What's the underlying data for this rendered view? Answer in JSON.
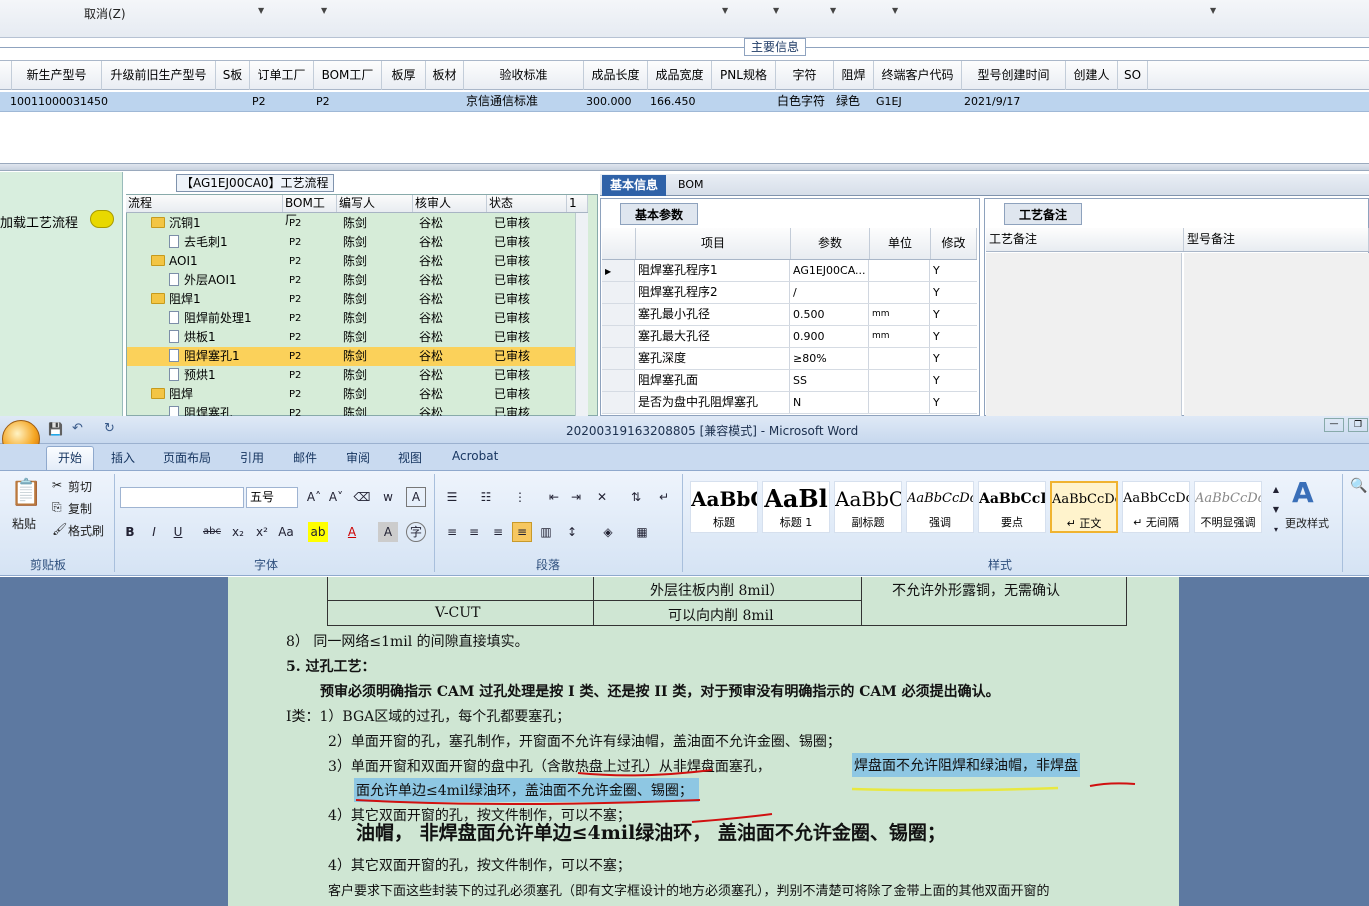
{
  "erp": {
    "cancel_label": "取消(Z)",
    "section_title": "主要信息",
    "columns": [
      "新生产型号",
      "升级前旧生产型号",
      "S板",
      "订单工厂",
      "BOM工厂",
      "板厚",
      "板材",
      "验收标准",
      "成品长度",
      "成品宽度",
      "PNL规格",
      "字符",
      "阻焊",
      "终端客户代码",
      "型号创建时间",
      "创建人",
      "SO"
    ],
    "row": [
      "10011000031450",
      "",
      "",
      "P2",
      "P2",
      "",
      "",
      "京信通信标准",
      "300.000",
      "166.450",
      "",
      "白色字符",
      "绿色",
      "G1EJ",
      "2021/9/17",
      "",
      ""
    ]
  },
  "flow": {
    "left_label": "加载工艺流程",
    "title": "【AG1EJ00CA0】工艺流程",
    "columns": [
      "流程",
      "BOM工厂",
      "编写人",
      "核审人",
      "状态",
      "1"
    ],
    "rows": [
      {
        "name": "沉铜1",
        "type": "folder",
        "level": 0,
        "bom": "P2",
        "writer": "陈剑",
        "reviewer": "谷松",
        "status": "已审核"
      },
      {
        "name": "去毛刺1",
        "type": "doc",
        "level": 1,
        "bom": "P2",
        "writer": "陈剑",
        "reviewer": "谷松",
        "status": "已审核"
      },
      {
        "name": "AOI1",
        "type": "folder",
        "level": 0,
        "bom": "P2",
        "writer": "陈剑",
        "reviewer": "谷松",
        "status": "已审核"
      },
      {
        "name": "外层AOI1",
        "type": "doc",
        "level": 1,
        "bom": "P2",
        "writer": "陈剑",
        "reviewer": "谷松",
        "status": "已审核"
      },
      {
        "name": "阻焊1",
        "type": "folder",
        "level": 0,
        "bom": "P2",
        "writer": "陈剑",
        "reviewer": "谷松",
        "status": "已审核"
      },
      {
        "name": "阻焊前处理1",
        "type": "doc",
        "level": 1,
        "bom": "P2",
        "writer": "陈剑",
        "reviewer": "谷松",
        "status": "已审核"
      },
      {
        "name": "烘板1",
        "type": "doc",
        "level": 1,
        "bom": "P2",
        "writer": "陈剑",
        "reviewer": "谷松",
        "status": "已审核"
      },
      {
        "name": "阻焊塞孔1",
        "type": "doc",
        "level": 1,
        "bom": "P2",
        "writer": "陈剑",
        "reviewer": "谷松",
        "status": "已审核",
        "selected": true
      },
      {
        "name": "预烘1",
        "type": "doc",
        "level": 1,
        "bom": "P2",
        "writer": "陈剑",
        "reviewer": "谷松",
        "status": "已审核"
      },
      {
        "name": "阻焊",
        "type": "folder",
        "level": 0,
        "bom": "P2",
        "writer": "陈剑",
        "reviewer": "谷松",
        "status": "已审核"
      },
      {
        "name": "阻焊塞孔",
        "type": "doc",
        "level": 1,
        "bom": "P2",
        "writer": "陈剑",
        "reviewer": "谷松",
        "status": "已审核"
      }
    ]
  },
  "basic": {
    "tab_active": "基本信息",
    "tab_bom": "BOM",
    "subtab": "基本参数",
    "columns": [
      "项目",
      "参数",
      "单位",
      "修改"
    ],
    "rows": [
      {
        "item": "阻焊塞孔程序1",
        "param": "AG1EJ00CA...",
        "unit": "",
        "mod": "Y",
        "current": true
      },
      {
        "item": "阻焊塞孔程序2",
        "param": "/",
        "unit": "",
        "mod": "Y"
      },
      {
        "item": "塞孔最小孔径",
        "param": "0.500",
        "unit": "mm",
        "mod": "Y"
      },
      {
        "item": "塞孔最大孔径",
        "param": "0.900",
        "unit": "mm",
        "mod": "Y"
      },
      {
        "item": "塞孔深度",
        "param": "≥80%",
        "unit": "",
        "mod": "Y"
      },
      {
        "item": "阻焊塞孔面",
        "param": "SS",
        "unit": "",
        "mod": "Y"
      },
      {
        "item": "是否为盘中孔阻焊塞孔",
        "param": "N",
        "unit": "",
        "mod": "Y"
      }
    ],
    "remark_tab": "工艺备注",
    "remark_cols": [
      "工艺备注",
      "型号备注"
    ]
  },
  "word": {
    "title": "20200319163208805 [兼容模式] - Microsoft Word",
    "tabs": [
      "开始",
      "插入",
      "页面布局",
      "引用",
      "邮件",
      "审阅",
      "视图",
      "Acrobat"
    ],
    "clipboard": {
      "paste": "粘贴",
      "cut": "剪切",
      "copy": "复制",
      "format": "格式刷",
      "group": "剪贴板"
    },
    "font": {
      "size": "五号",
      "group": "字体"
    },
    "paragraph_group": "段落",
    "styles": [
      {
        "preview": "AaBbC",
        "name": "标题",
        "size": "20px",
        "bold": true
      },
      {
        "preview": "AaBl",
        "name": "标题 1",
        "size": "24px",
        "bold": true
      },
      {
        "preview": "AaBbC",
        "name": "副标题",
        "size": "20px",
        "bold": false
      },
      {
        "preview": "AaBbCcDc",
        "name": "强调",
        "size": "13px",
        "bold": false,
        "italic": true
      },
      {
        "preview": "AaBbCcD",
        "name": "要点",
        "size": "14px",
        "bold": true
      },
      {
        "preview": "AaBbCcDc",
        "name": "↵ 正文",
        "size": "13px",
        "bold": false,
        "active": true
      },
      {
        "preview": "AaBbCcDc",
        "name": "↵ 无间隔",
        "size": "13px",
        "bold": false
      },
      {
        "preview": "AaBbCcDc",
        "name": "不明显强调",
        "size": "13px",
        "bold": false,
        "italic": true,
        "muted": true
      }
    ],
    "change_style": "更改样式",
    "styles_group": "样式"
  },
  "doc": {
    "table_row1_c2": "外层往板内削 8mil）",
    "table_row1_c3": "不允许外形露铜，无需确认",
    "table_row2_c1": "V-CUT",
    "table_row2_c2": "可以向内削 8mil",
    "l1": "8） 同一网络≤1mil 的间隙直接填实。",
    "l2": "5.   过孔工艺：",
    "l3": "预审必须明确指示 CAM 过孔处理是按 I 类、还是按 II 类，对于预审没有明确指示的 CAM 必须提出确认。",
    "l4": "I类：1）BGA区域的过孔，每个孔都要塞孔；",
    "l5": "2）单面开窗的孔，塞孔制作，开窗面不允许有绿油帽，盖油面不允许金圈、锡圈；",
    "l6a": "3）单面开窗和双面开窗的盘中孔（含散热盘上过孔）从非焊盘面塞孔，",
    "l6b": "焊盘面不允许阻焊和绿油帽，非焊盘",
    "l7": "面允许单边≤4mil绿油环，盖油面不允许金圈、锡圈；",
    "l8": "4）其它双面开窗的孔，按文件制作，可以不塞；",
    "l9": "油帽， 非焊盘面允许单边≤4mil绿油环， 盖油面不允许金圈、锡圈；",
    "l10": "4）其它双面开窗的孔，按文件制作，可以不塞；",
    "l11": "客户要求下面这些封装下的过孔必须塞孔（即有文字框设计的地方必须塞孔），判别不清楚可将除了金带上面的其他双面开窗的"
  }
}
